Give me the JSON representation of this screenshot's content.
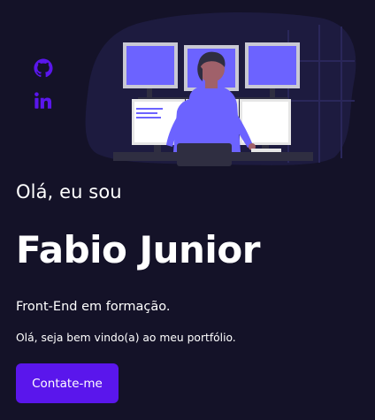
{
  "social": {
    "icons": [
      "github-icon",
      "linkedin-icon"
    ],
    "icon_color": "#5a16ec"
  },
  "hero": {
    "greeting": "Olá, eu sou",
    "name": "Fabio Junior",
    "role": "Front-End em formação.",
    "welcome": "Olá, seja bem vindo(a) ao meu portfólio.",
    "cta_label": "Contate-me"
  },
  "colors": {
    "background": "#141228",
    "accent": "#5a16ec",
    "illustration_accent": "#6c63ff",
    "text": "#ffffff"
  }
}
